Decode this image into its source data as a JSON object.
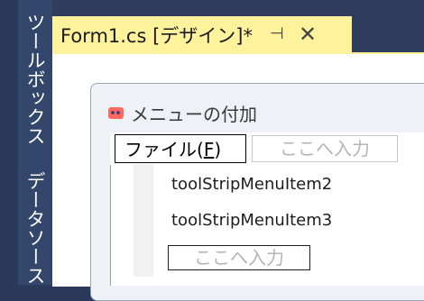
{
  "side_panel": {
    "toolbox_label": "ツールボックス",
    "datasource_label": "データソース"
  },
  "tab": {
    "title": "Form1.cs [デザイン]*",
    "pin_glyph": "⊣",
    "close_glyph": "✕"
  },
  "form": {
    "title": "メニューの付加",
    "icon": "form-icon"
  },
  "menu": {
    "file_label_prefix": "ファイル(",
    "file_mnemonic": "F",
    "file_label_suffix": ")",
    "type_here": "ここへ入力"
  },
  "dropdown": {
    "items": [
      "toolStripMenuItem2",
      "toolStripMenuItem3"
    ],
    "type_here": "ここへ入力"
  },
  "colors": {
    "tab_active": "#fff29d",
    "side_bar": "#33466c",
    "form_background": "#eef1f6"
  }
}
